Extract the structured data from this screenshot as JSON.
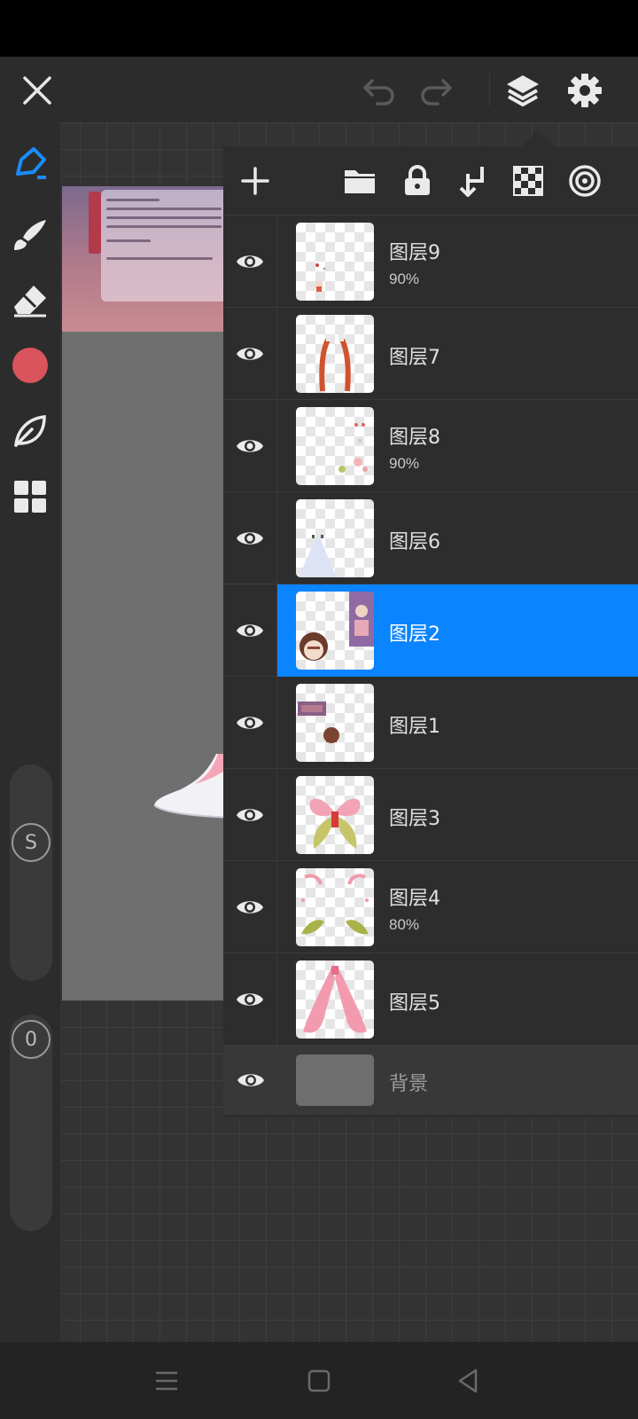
{
  "toolbar": {
    "close_icon": "close-icon",
    "undo_icon": "undo-icon",
    "redo_icon": "redo-icon",
    "layers_icon": "layers-icon",
    "settings_icon": "gear-icon"
  },
  "left_tools": {
    "items": [
      "pen-icon",
      "brush-icon",
      "eraser-icon",
      "color-swatch",
      "leaf-icon",
      "grid-icon"
    ],
    "active_color": "#d9545c",
    "accent": "#1a8cff",
    "size_label": "S",
    "opacity_label": "0"
  },
  "layer_panel": {
    "header_icons": [
      "add-icon",
      "folder-icon",
      "lock-icon",
      "merge-down-icon",
      "transparency-icon",
      "blend-icon"
    ],
    "layers": [
      {
        "name": "图层9",
        "opacity": "90%"
      },
      {
        "name": "图层7",
        "opacity": ""
      },
      {
        "name": "图层8",
        "opacity": "90%"
      },
      {
        "name": "图层6",
        "opacity": ""
      },
      {
        "name": "图层2",
        "opacity": "",
        "selected": true
      },
      {
        "name": "图层1",
        "opacity": ""
      },
      {
        "name": "图层3",
        "opacity": ""
      },
      {
        "name": "图层4",
        "opacity": "80%"
      },
      {
        "name": "图层5",
        "opacity": ""
      },
      {
        "name": "背景",
        "opacity": "",
        "background": true
      }
    ]
  },
  "colors": {
    "selected_row": "#0a84ff",
    "panel_bg": "#2d2d2d"
  }
}
